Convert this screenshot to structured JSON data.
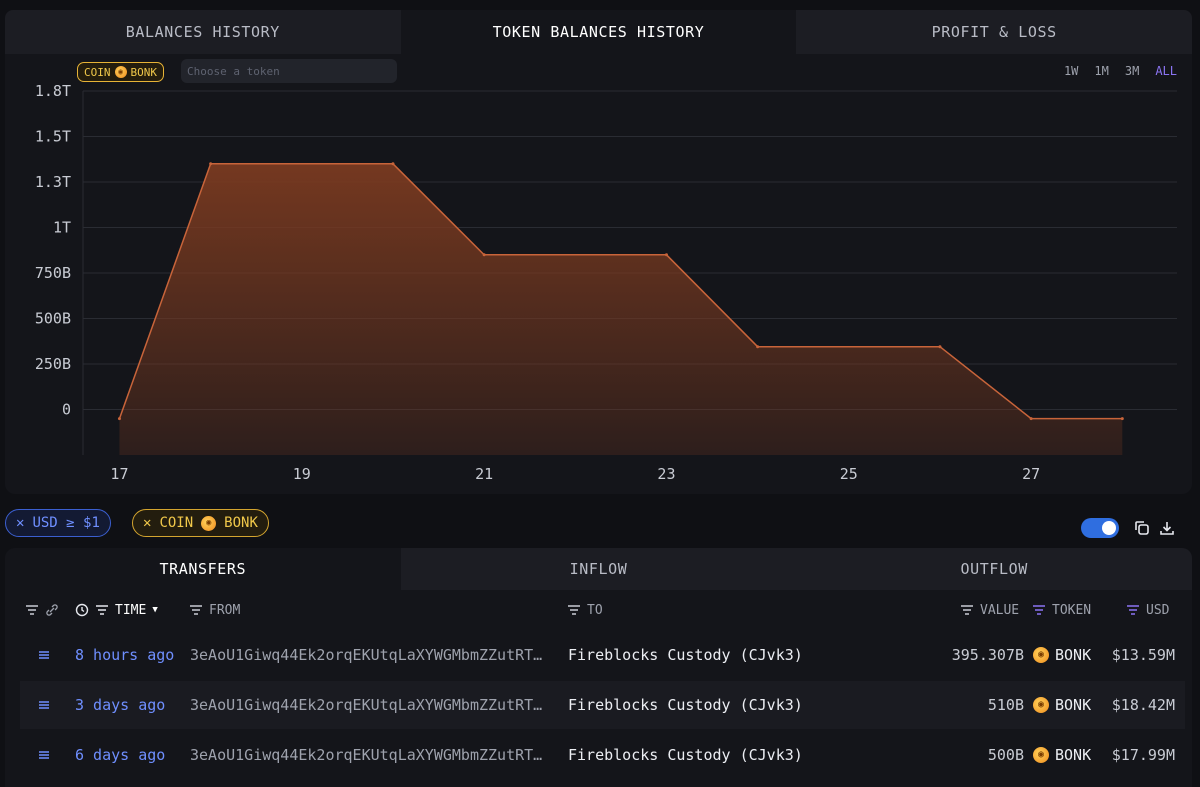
{
  "top_tabs": [
    {
      "label": "BALANCES HISTORY",
      "active": false
    },
    {
      "label": "TOKEN BALANCES HISTORY",
      "active": true
    },
    {
      "label": "PROFIT & LOSS",
      "active": false
    }
  ],
  "chart_controls": {
    "coin_chip": {
      "prefix": "COIN",
      "token": "BONK"
    },
    "token_input_placeholder": "Choose a token",
    "ranges": [
      "1W",
      "1M",
      "3M",
      "ALL"
    ],
    "active_range": "ALL"
  },
  "chart_data": {
    "type": "area",
    "x": [
      17,
      18,
      20,
      21,
      23,
      24,
      26,
      27,
      28
    ],
    "values": [
      0,
      1400000000000.0,
      1400000000000.0,
      900000000000.0,
      900000000000.0,
      395000000000.0,
      395000000000.0,
      0,
      0
    ],
    "ylim": [
      -200000000000.0,
      1800000000000.0
    ],
    "xlim": [
      16.6,
      28.6
    ],
    "yticks": [
      {
        "value": 1800000000000.0,
        "label": "1.8T"
      },
      {
        "value": 1550000000000.0,
        "label": "1.5T"
      },
      {
        "value": 1300000000000.0,
        "label": "1.3T"
      },
      {
        "value": 1050000000000.0,
        "label": "1T"
      },
      {
        "value": 800000000000.0,
        "label": "750B"
      },
      {
        "value": 550000000000.0,
        "label": "500B"
      },
      {
        "value": 300000000000.0,
        "label": "250B"
      },
      {
        "value": 50000000000.0,
        "label": "0"
      }
    ],
    "xticks": [
      17,
      19,
      21,
      23,
      25,
      27
    ],
    "grid": true,
    "line_color": "#c8643a",
    "fill_color": "#7a3a20"
  },
  "filters": {
    "usd_chip": "USD ≥ $1",
    "coin_chip": {
      "prefix": "COIN",
      "token": "BONK"
    }
  },
  "table_tabs": [
    {
      "label": "TRANSFERS",
      "active": true
    },
    {
      "label": "INFLOW",
      "active": false
    },
    {
      "label": "OUTFLOW",
      "active": false
    }
  ],
  "columns": {
    "time": "TIME",
    "from": "FROM",
    "to": "TO",
    "value": "VALUE",
    "token": "TOKEN",
    "usd": "USD"
  },
  "rows": [
    {
      "time": "8 hours ago",
      "from": "3eAoU1Giwq44Ek2orqEKUtqLaXYWGMbmZZutRT…",
      "to": "Fireblocks Custody (CJvk3)",
      "value": "395.307B",
      "token": "BONK",
      "usd": "$13.59M"
    },
    {
      "time": "3 days ago",
      "from": "3eAoU1Giwq44Ek2orqEKUtqLaXYWGMbmZZutRT…",
      "to": "Fireblocks Custody (CJvk3)",
      "value": "510B",
      "token": "BONK",
      "usd": "$18.42M"
    },
    {
      "time": "6 days ago",
      "from": "3eAoU1Giwq44Ek2orqEKUtqLaXYWGMbmZZutRT…",
      "to": "Fireblocks Custody (CJvk3)",
      "value": "500B",
      "token": "BONK",
      "usd": "$17.99M"
    }
  ],
  "colors": {
    "accent_purple": "#8b74f3",
    "link_blue": "#6f8fff",
    "coin_gold": "#f0c84a",
    "toggle_blue": "#2f6ee0"
  }
}
